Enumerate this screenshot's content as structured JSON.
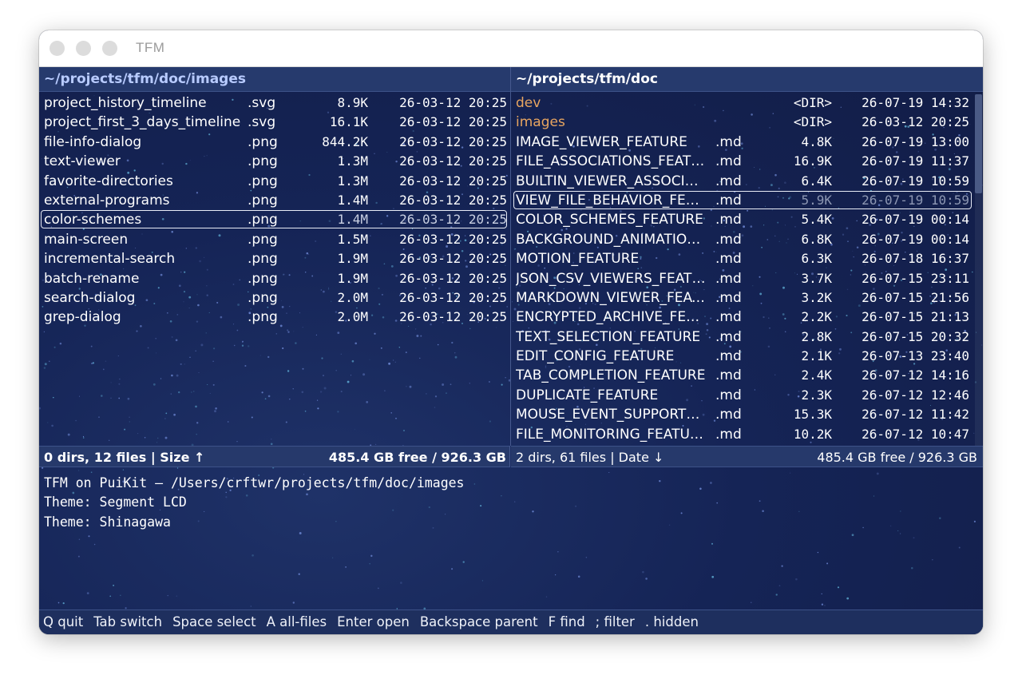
{
  "window": {
    "title": "TFM"
  },
  "colors": {
    "dir": "#e8a560",
    "file": "#ffffff",
    "left_path": "#b8cbff",
    "right_path": "#ffffff",
    "dim": "#8d97b3"
  },
  "left": {
    "path": "~/projects/tfm/doc/images",
    "files": [
      {
        "name": "project_history_timeline",
        "ext": ".svg",
        "size": "8.9K",
        "date": "26-03-12 20:25"
      },
      {
        "name": "project_first_3_days_timeline",
        "ext": ".svg",
        "size": "16.1K",
        "date": "26-03-12 20:25"
      },
      {
        "name": "file-info-dialog",
        "ext": ".png",
        "size": "844.2K",
        "date": "26-03-12 20:25"
      },
      {
        "name": "text-viewer",
        "ext": ".png",
        "size": "1.3M",
        "date": "26-03-12 20:25"
      },
      {
        "name": "favorite-directories",
        "ext": ".png",
        "size": "1.3M",
        "date": "26-03-12 20:25"
      },
      {
        "name": "external-programs",
        "ext": ".png",
        "size": "1.4M",
        "date": "26-03-12 20:25"
      },
      {
        "name": "color-schemes",
        "ext": ".png",
        "size": "1.4M",
        "date": "26-03-12 20:25",
        "selected": true
      },
      {
        "name": "main-screen",
        "ext": ".png",
        "size": "1.5M",
        "date": "26-03-12 20:25"
      },
      {
        "name": "incremental-search",
        "ext": ".png",
        "size": "1.9M",
        "date": "26-03-12 20:25"
      },
      {
        "name": "batch-rename",
        "ext": ".png",
        "size": "1.9M",
        "date": "26-03-12 20:25"
      },
      {
        "name": "search-dialog",
        "ext": ".png",
        "size": "2.0M",
        "date": "26-03-12 20:25"
      },
      {
        "name": "grep-dialog",
        "ext": ".png",
        "size": "2.0M",
        "date": "26-03-12 20:25"
      }
    ],
    "status_left": "0 dirs, 12 files  |  Size ↑",
    "status_right": "485.4 GB free / 926.3 GB"
  },
  "right": {
    "path": "~/projects/tfm/doc",
    "files": [
      {
        "name": "dev",
        "ext": "",
        "size": "<DIR>",
        "date": "26-07-19 14:32",
        "dir": true
      },
      {
        "name": "images",
        "ext": "",
        "size": "<DIR>",
        "date": "26-03-12 20:25",
        "dir": true
      },
      {
        "name": "IMAGE_VIEWER_FEATURE",
        "ext": ".md",
        "size": "4.8K",
        "date": "26-07-19 13:00"
      },
      {
        "name": "FILE_ASSOCIATIONS_FEATU…",
        "ext": ".md",
        "size": "16.9K",
        "date": "26-07-19 11:37"
      },
      {
        "name": "BUILTIN_VIEWER_ASSOCIA…",
        "ext": ".md",
        "size": "6.4K",
        "date": "26-07-19 10:59"
      },
      {
        "name": "VIEW_FILE_BEHAVIOR_FEAT…",
        "ext": ".md",
        "size": "5.9K",
        "date": "26-07-19 10:59",
        "selected": true
      },
      {
        "name": "COLOR_SCHEMES_FEATURE",
        "ext": ".md",
        "size": "5.4K",
        "date": "26-07-19 00:14"
      },
      {
        "name": "BACKGROUND_ANIMATION…",
        "ext": ".md",
        "size": "6.8K",
        "date": "26-07-19 00:14"
      },
      {
        "name": "MOTION_FEATURE",
        "ext": ".md",
        "size": "6.3K",
        "date": "26-07-18 16:37"
      },
      {
        "name": "JSON_CSV_VIEWERS_FEATURE",
        "ext": ".md",
        "size": "3.7K",
        "date": "26-07-15 23:11"
      },
      {
        "name": "MARKDOWN_VIEWER_FEAT…",
        "ext": ".md",
        "size": "3.2K",
        "date": "26-07-15 21:56"
      },
      {
        "name": "ENCRYPTED_ARCHIVE_FEAT…",
        "ext": ".md",
        "size": "2.2K",
        "date": "26-07-15 21:13"
      },
      {
        "name": "TEXT_SELECTION_FEATURE",
        "ext": ".md",
        "size": "2.8K",
        "date": "26-07-15 20:32"
      },
      {
        "name": "EDIT_CONFIG_FEATURE",
        "ext": ".md",
        "size": "2.1K",
        "date": "26-07-13 23:40"
      },
      {
        "name": "TAB_COMPLETION_FEATURE",
        "ext": ".md",
        "size": "2.4K",
        "date": "26-07-12 14:16"
      },
      {
        "name": "DUPLICATE_FEATURE",
        "ext": ".md",
        "size": "2.3K",
        "date": "26-07-12 12:46"
      },
      {
        "name": "MOUSE_EVENT_SUPPORT_F…",
        "ext": ".md",
        "size": "15.3K",
        "date": "26-07-12 11:42"
      },
      {
        "name": "FILE_MONITORING_FEATURE",
        "ext": ".md",
        "size": "10.2K",
        "date": "26-07-12 10:47"
      }
    ],
    "status_left": "2 dirs, 61 files  |  Date ↓",
    "status_right": "485.4 GB free / 926.3 GB",
    "scroll_position": 0.0
  },
  "log": [
    "TFM on PuiKit — /Users/crftwr/projects/tfm/doc/images",
    "Theme: Segment LCD",
    "Theme: Shinagawa"
  ],
  "shortcuts": [
    "Q quit",
    "Tab switch",
    "Space select",
    "A all-files",
    "Enter open",
    "Backspace parent",
    "F find",
    "; filter",
    ". hidden"
  ]
}
